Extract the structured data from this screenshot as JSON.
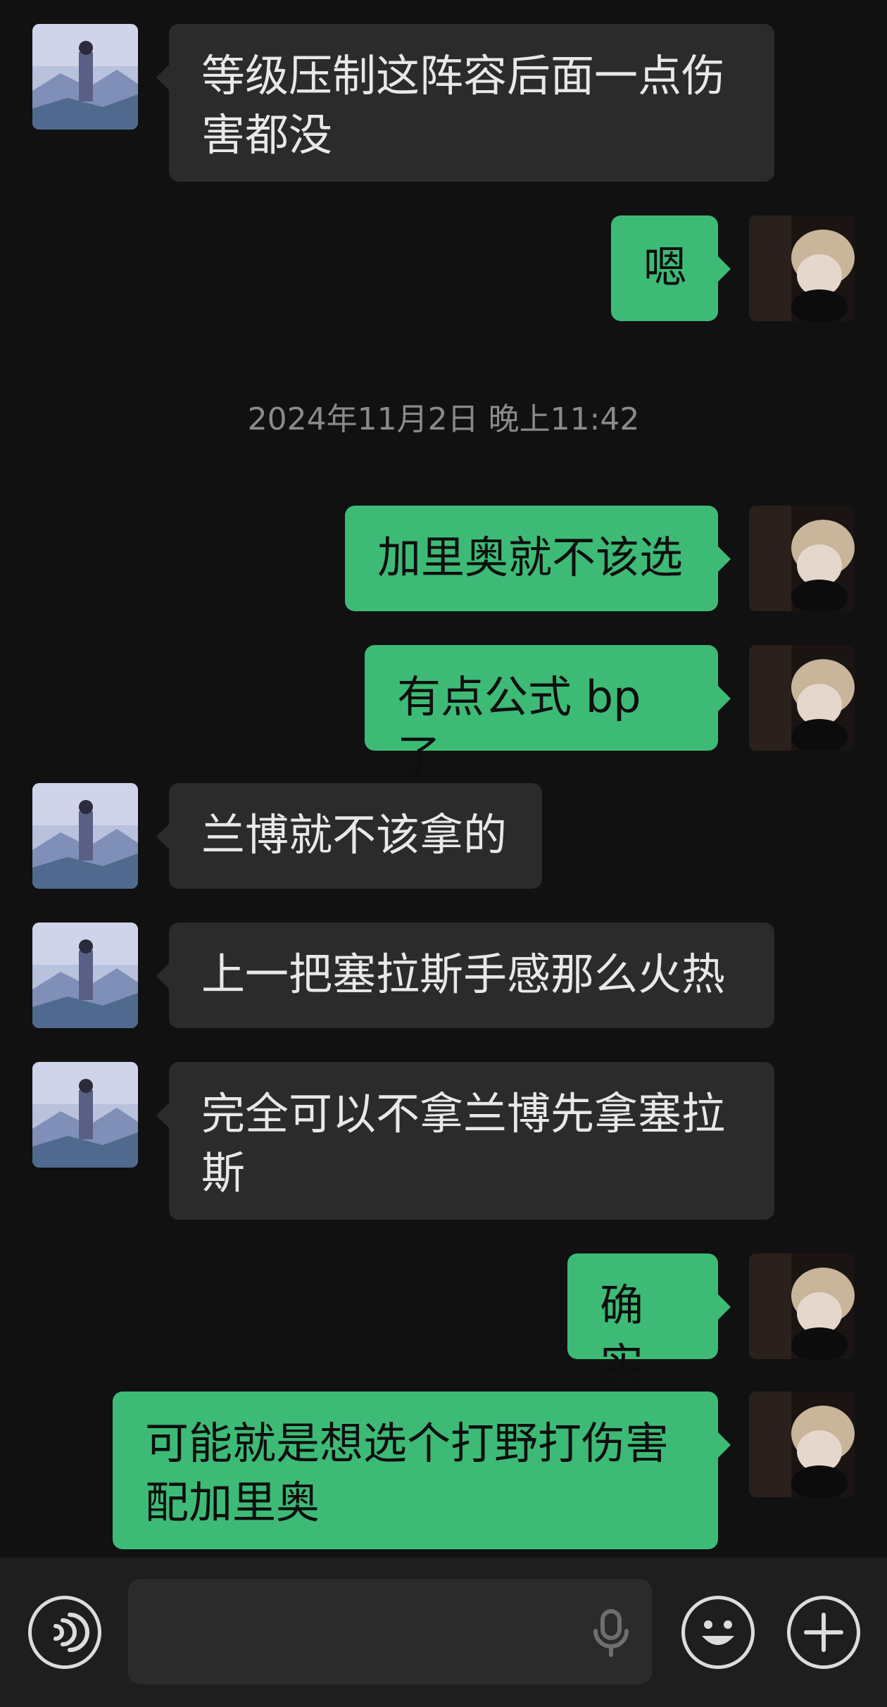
{
  "chat": {
    "messages": [
      {
        "side": "in",
        "text": "等级压制这阵容后面一点伤害都没"
      },
      {
        "side": "out",
        "text": "嗯"
      },
      {
        "side": "out",
        "text": "加里奥就不该选"
      },
      {
        "side": "out",
        "text": "有点公式 bp 了"
      },
      {
        "side": "in",
        "text": "兰博就不该拿的"
      },
      {
        "side": "in",
        "text": "上一把塞拉斯手感那么火热"
      },
      {
        "side": "in",
        "text": "完全可以不拿兰博先拿塞拉斯"
      },
      {
        "side": "out",
        "text": "确实"
      },
      {
        "side": "out",
        "text": "可能就是想选个打野打伤害配加里奥"
      }
    ],
    "timestamp": "2024年11月2日 晚上11:42"
  },
  "input_bar": {
    "voice_icon": "voice-icon",
    "mic_icon": "microphone-icon",
    "emoji_icon": "emoji-icon",
    "plus_icon": "plus-icon",
    "input_value": ""
  },
  "colors": {
    "background": "#111111",
    "incoming_bubble": "#2b2b2b",
    "outgoing_bubble": "#3dbb76",
    "timestamp_text": "#8a8a8a"
  }
}
